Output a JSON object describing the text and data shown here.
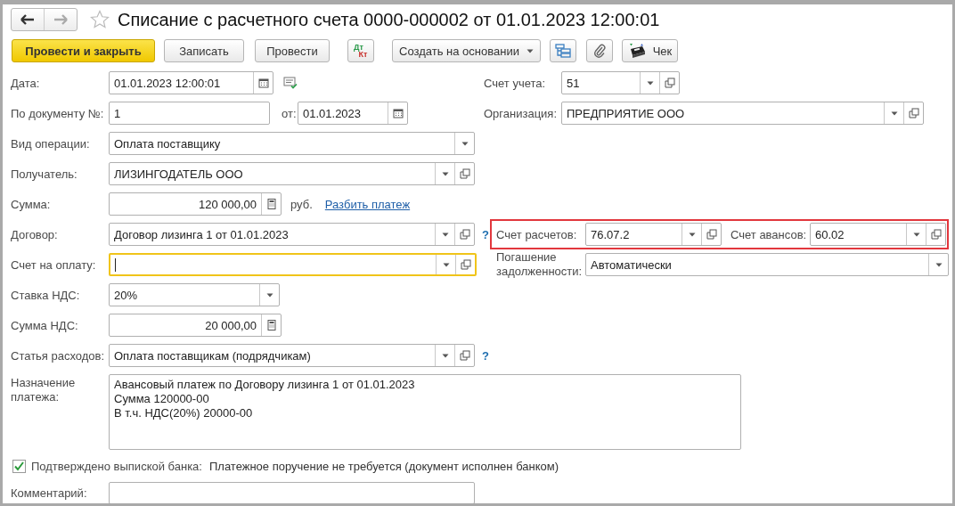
{
  "window": {
    "title": "Списание с расчетного счета 0000-000002 от 01.01.2023 12:00:01"
  },
  "toolbar": [
    {
      "kind": "primary",
      "label": "Провести и закрыть"
    },
    {
      "kind": "button",
      "label": "Записать"
    },
    {
      "kind": "button",
      "label": "Провести"
    },
    {
      "kind": "dtkt",
      "label": "Дт",
      "sublabel": "Кт"
    },
    {
      "kind": "menu",
      "label": "Создать на основании"
    },
    {
      "kind": "structure"
    },
    {
      "kind": "attach"
    },
    {
      "kind": "receipt",
      "label": "Чек"
    }
  ],
  "date": {
    "label": "Дата:",
    "kind": "date",
    "value": "01.01.2023 12:00:01"
  },
  "doc_number": {
    "label": "По документу №:",
    "kind": "text",
    "value": "1"
  },
  "doc_date": {
    "label": "от:",
    "kind": "date",
    "value": "01.01.2023"
  },
  "operation": {
    "label": "Вид операции:",
    "kind": "select",
    "value": "Оплата поставщику"
  },
  "recipient": {
    "label": "Получатель:",
    "kind": "ref",
    "value": "ЛИЗИНГОДАТЕЛЬ ООО"
  },
  "amount": {
    "label": "Сумма:",
    "kind": "number",
    "value": "120 000,00",
    "currency": "руб.",
    "link": "Разбить платеж"
  },
  "contract": {
    "label": "Договор:",
    "kind": "ref",
    "value": "Договор лизинга 1 от 01.01.2023",
    "help": "?"
  },
  "invoice": {
    "label": "Счет на оплату:",
    "kind": "ref",
    "focused": true
  },
  "vat_rate": {
    "label": "Ставка НДС:",
    "kind": "select",
    "value": "20%"
  },
  "vat_amount": {
    "label": "Сумма НДС:",
    "kind": "number",
    "value": "20 000,00"
  },
  "expense_item": {
    "label": "Статья расходов:",
    "kind": "ref",
    "value": "Оплата поставщикам (подрядчикам)",
    "help": "?"
  },
  "purpose": {
    "label": "Назначение платежа:",
    "lines": [
      "Авансовый платеж по Договору лизинга 1 от 01.01.2023",
      "Сумма 120000-00",
      "В т.ч. НДС(20%) 20000-00"
    ]
  },
  "bank_confirmed": {
    "label": "Подтверждено выпиской банка:",
    "checked": true,
    "note": "Платежное поручение не требуется (документ исполнен банком)"
  },
  "comment": {
    "label": "Комментарий:",
    "kind": "text"
  },
  "account": {
    "label": "Счет учета:",
    "kind": "ref",
    "value": "51"
  },
  "organization": {
    "label": "Организация:",
    "kind": "ref",
    "value": "ПРЕДПРИЯТИЕ ООО"
  },
  "settlement": {
    "highlighted": true,
    "fields": [
      {
        "label": "Счет расчетов:",
        "kind": "ref",
        "value": "76.07.2"
      },
      {
        "label": "Счет авансов:",
        "kind": "ref",
        "value": "60.02"
      }
    ]
  },
  "repayment": {
    "label": "Погашение задолженности:",
    "kind": "select",
    "value": "Автоматически"
  }
}
